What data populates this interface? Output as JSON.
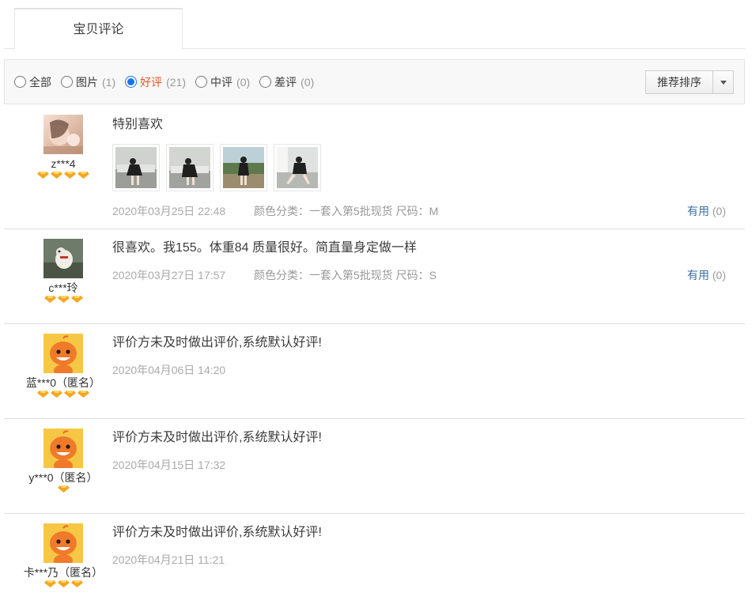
{
  "tabs": {
    "active_label": "宝贝评论"
  },
  "filters": [
    {
      "label": "全部",
      "count": "",
      "checked": false
    },
    {
      "label": "图片",
      "count": "(1)",
      "checked": false
    },
    {
      "label": "好评",
      "count": "(21)",
      "checked": true
    },
    {
      "label": "中评",
      "count": "(0)",
      "checked": false
    },
    {
      "label": "差评",
      "count": "(0)",
      "checked": false
    }
  ],
  "sort": {
    "label": "推荐排序"
  },
  "reviews": [
    {
      "user": "z***4",
      "medals": 4,
      "avatar": "photo-avatar-girl",
      "text": "特别喜欢",
      "photos": 4,
      "date": "2020年03月25日 22:48",
      "spec": "颜色分类：一套入第5批现货  尺码：M",
      "useful_label": "有用",
      "useful_count": "(0)"
    },
    {
      "user": "c***玲",
      "medals": 3,
      "avatar": "photo-avatar-dog",
      "text": "很喜欢。我155。体重84 质量很好。简直量身定做一样",
      "photos": 0,
      "date": "2020年03月27日 17:57",
      "spec": "颜色分类：一套入第5批现货  尺码：S",
      "useful_label": "有用",
      "useful_count": "(0)"
    },
    {
      "user": "蓝***0（匿名）",
      "medals": 4,
      "avatar": "default-taobao-avatar",
      "text": "评价方未及时做出评价,系统默认好评!",
      "photos": 0,
      "date": "2020年04月06日 14:20",
      "spec": "",
      "useful_label": "",
      "useful_count": ""
    },
    {
      "user": "y***0（匿名）",
      "medals": 1,
      "avatar": "default-taobao-avatar",
      "text": "评价方未及时做出评价,系统默认好评!",
      "photos": 0,
      "date": "2020年04月15日 17:32",
      "spec": "",
      "useful_label": "",
      "useful_count": ""
    },
    {
      "user": "卡***乃（匿名）",
      "medals": 3,
      "avatar": "default-taobao-avatar",
      "text": "评价方未及时做出评价,系统默认好评!",
      "photos": 0,
      "date": "2020年04月21日 11:21",
      "spec": "",
      "useful_label": "",
      "useful_count": ""
    }
  ],
  "colors": {
    "accent": "#e4582b",
    "link": "#3c6ea5",
    "muted": "#aaaaaa",
    "medal": "#f5a623"
  }
}
